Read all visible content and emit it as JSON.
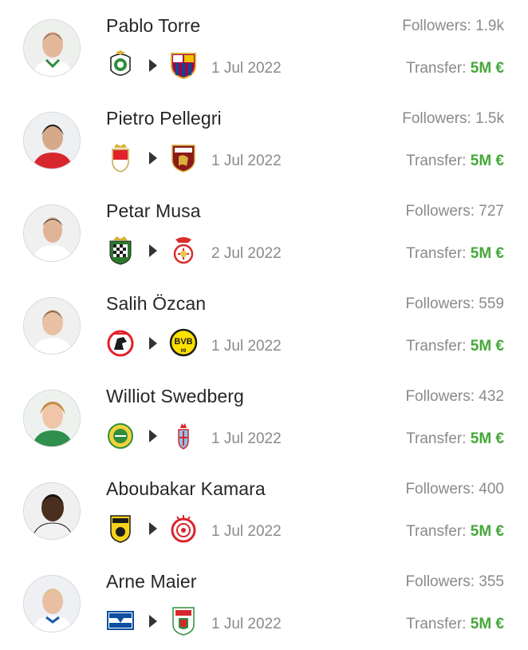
{
  "players": [
    {
      "name": "Pablo Torre",
      "followers": "Followers: 1.9k",
      "date": "1 Jul 2022",
      "transfer_label": "Transfer:",
      "fee": "5M €",
      "from_club": "racing-santander-crest",
      "to_club": "fc-barcelona-crest"
    },
    {
      "name": "Pietro Pellegri",
      "followers": "Followers: 1.5k",
      "date": "1 Jul 2022",
      "transfer_label": "Transfer:",
      "fee": "5M €",
      "from_club": "as-monaco-crest",
      "to_club": "torino-crest"
    },
    {
      "name": "Petar Musa",
      "followers": "Followers: 727",
      "date": "2 Jul 2022",
      "transfer_label": "Transfer:",
      "fee": "5M €",
      "from_club": "boavista-crest",
      "to_club": "benfica-crest"
    },
    {
      "name": "Salih Özcan",
      "followers": "Followers: 559",
      "date": "1 Jul 2022",
      "transfer_label": "Transfer:",
      "fee": "5M €",
      "from_club": "fc-koln-crest",
      "to_club": "borussia-dortmund-crest"
    },
    {
      "name": "Williot Swedberg",
      "followers": "Followers: 432",
      "date": "1 Jul 2022",
      "transfer_label": "Transfer:",
      "fee": "5M €",
      "from_club": "hammarby-crest",
      "to_club": "celta-vigo-crest"
    },
    {
      "name": "Aboubakar Kamara",
      "followers": "Followers: 400",
      "date": "1 Jul 2022",
      "transfer_label": "Transfer:",
      "fee": "5M €",
      "from_club": "aris-crest",
      "to_club": "olympiacos-crest"
    },
    {
      "name": "Arne Maier",
      "followers": "Followers: 355",
      "date": "1 Jul 2022",
      "transfer_label": "Transfer:",
      "fee": "5M €",
      "from_club": "hertha-bsc-crest",
      "to_club": "fc-augsburg-crest"
    }
  ],
  "colors": {
    "fee": "#45a839",
    "muted": "#8a8a8a",
    "name": "#262626"
  }
}
